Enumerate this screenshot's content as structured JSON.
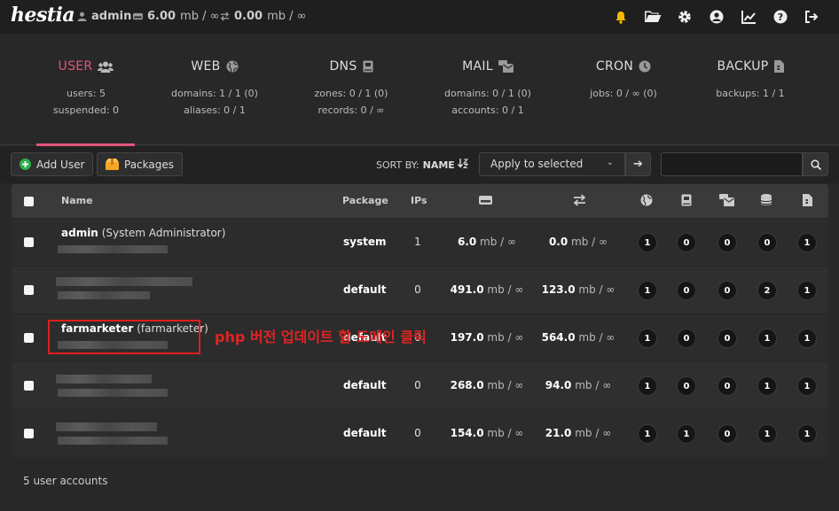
{
  "topbar": {
    "logo": "hestia",
    "user": "admin",
    "disk_value": "6.00",
    "disk_unit": "mb / ∞",
    "bw_value": "0.00",
    "bw_unit": "mb / ∞"
  },
  "stats": [
    {
      "title": "USER",
      "line1": "users: 5",
      "line2": "suspended: 0",
      "icon": "users-icon"
    },
    {
      "title": "WEB",
      "line1": "domains: 1 / 1 (0)",
      "line2": "aliases: 0 / 1",
      "icon": "globe-icon"
    },
    {
      "title": "DNS",
      "line1": "zones: 0 / 1 (0)",
      "line2": "records: 0 / ∞",
      "icon": "book-icon"
    },
    {
      "title": "MAIL",
      "line1": "domains: 0 / 1 (0)",
      "line2": "accounts: 0 / 1",
      "icon": "mail-bulk-icon"
    },
    {
      "title": "CRON",
      "line1": "jobs: 0 / ∞ (0)",
      "line2": "",
      "icon": "clock-icon"
    },
    {
      "title": "BACKUP",
      "line1": "backups: 1 / 1",
      "line2": "",
      "icon": "file-icon"
    }
  ],
  "toolbar": {
    "add_user": "Add User",
    "packages": "Packages",
    "sort_by": "SORT BY:",
    "sort_field": "NAME",
    "apply_selected": "Apply to selected",
    "search_value": ""
  },
  "table": {
    "headers": {
      "name": "Name",
      "package": "Package",
      "ips": "IPs"
    },
    "rows": [
      {
        "username": "admin",
        "fullname": "(System Administrator)",
        "package": "system",
        "ips": "1",
        "disk": "6.0",
        "disk_unit": "mb / ∞",
        "bw": "0.0",
        "bw_unit": "mb / ∞",
        "web": "1",
        "dns": "0",
        "mail": "0",
        "db": "0",
        "backup": "1"
      },
      {
        "username": "",
        "fullname": "",
        "package": "default",
        "ips": "0",
        "disk": "491.0",
        "disk_unit": "mb / ∞",
        "bw": "123.0",
        "bw_unit": "mb / ∞",
        "web": "1",
        "dns": "0",
        "mail": "0",
        "db": "2",
        "backup": "1"
      },
      {
        "username": "farmarketer",
        "fullname": "(farmarketer)",
        "package": "default",
        "ips": "0",
        "disk": "197.0",
        "disk_unit": "mb / ∞",
        "bw": "564.0",
        "bw_unit": "mb / ∞",
        "web": "1",
        "dns": "0",
        "mail": "0",
        "db": "1",
        "backup": "1"
      },
      {
        "username": "",
        "fullname": "",
        "package": "default",
        "ips": "0",
        "disk": "268.0",
        "disk_unit": "mb / ∞",
        "bw": "94.0",
        "bw_unit": "mb / ∞",
        "web": "1",
        "dns": "0",
        "mail": "0",
        "db": "1",
        "backup": "1"
      },
      {
        "username": "",
        "fullname": "",
        "package": "default",
        "ips": "0",
        "disk": "154.0",
        "disk_unit": "mb / ∞",
        "bw": "21.0",
        "bw_unit": "mb / ∞",
        "web": "1",
        "dns": "1",
        "mail": "0",
        "db": "1",
        "backup": "1"
      }
    ]
  },
  "footer": "5 user accounts",
  "annotation": "php 버전 업데이트 할 도메인 클릭",
  "colors": {
    "accent": "#e5547c",
    "annotation": "#e02424",
    "bell": "#f5b800"
  }
}
